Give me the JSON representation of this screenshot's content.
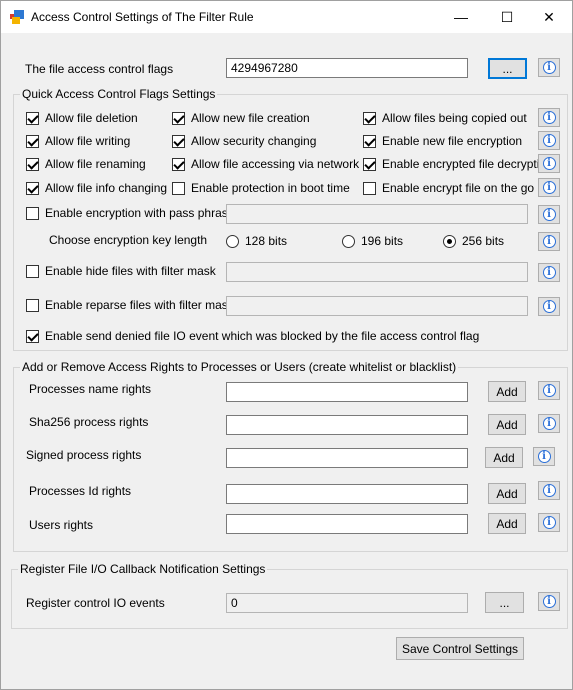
{
  "window": {
    "title": "Access Control Settings of The Filter Rule",
    "minimize_glyph": "—",
    "maximize_glyph": "☐",
    "close_glyph": "✕"
  },
  "flags": {
    "label": "The file access control flags",
    "value": "4294967280",
    "browse_label": "..."
  },
  "quick": {
    "title": "Quick Access Control Flags Settings",
    "checkboxes": [
      {
        "label": "Allow file deletion",
        "checked": true
      },
      {
        "label": "Allow new file creation",
        "checked": true
      },
      {
        "label": "Allow files being copied out",
        "checked": true
      },
      {
        "label": "Allow file writing",
        "checked": true
      },
      {
        "label": "Allow security changing",
        "checked": true
      },
      {
        "label": "Enable new file encryption",
        "checked": true
      },
      {
        "label": "Allow file renaming",
        "checked": true
      },
      {
        "label": "Allow file accessing via network",
        "checked": true
      },
      {
        "label": "Enable encrypted file decryption",
        "checked": true
      },
      {
        "label": "Allow file info changing",
        "checked": true
      },
      {
        "label": "Enable protection in boot time",
        "checked": false
      },
      {
        "label": "Enable encrypt file on the go",
        "checked": false
      }
    ],
    "pass_phrase_label": "Enable encryption with pass phrase",
    "pass_phrase_checked": false,
    "key_length_label": "Choose encryption key length",
    "key_options": [
      {
        "label": "128 bits",
        "checked": false
      },
      {
        "label": "196 bits",
        "checked": false
      },
      {
        "label": "256 bits",
        "checked": true
      }
    ],
    "hide_files_label": "Enable hide files with filter mask",
    "hide_files_checked": false,
    "reparse_label": "Enable reparse files with filter mask",
    "reparse_checked": false,
    "send_denied_label": "Enable send denied file IO event which was blocked by the file access control flag",
    "send_denied_checked": true
  },
  "rights": {
    "title": "Add or Remove Access Rights to Processes or Users (create whitelist or blacklist)",
    "rows": [
      {
        "label": "Processes name rights",
        "value": "",
        "button": "Add"
      },
      {
        "label": "Sha256 process rights",
        "value": "",
        "button": "Add"
      },
      {
        "label": "Signed process rights",
        "value": "",
        "button": "Add"
      },
      {
        "label": "Processes Id rights",
        "value": "",
        "button": "Add"
      },
      {
        "label": "Users rights",
        "value": "",
        "button": "Add"
      }
    ]
  },
  "callback": {
    "title": "Register File I/O Callback Notification Settings",
    "label": "Register control IO events",
    "value": "0",
    "browse_label": "..."
  },
  "save_label": "Save Control Settings"
}
